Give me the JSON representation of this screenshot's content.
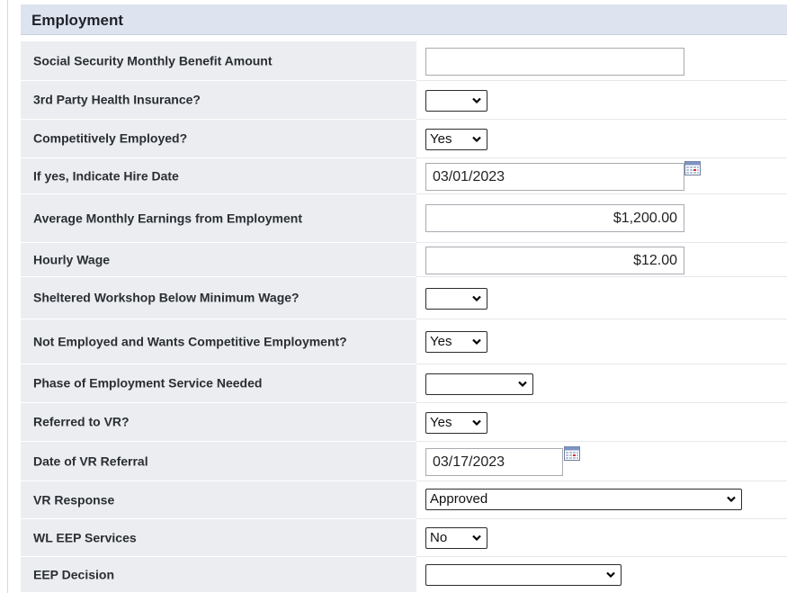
{
  "section": {
    "title": "Employment"
  },
  "fields": [
    {
      "label": "Social Security Monthly Benefit Amount",
      "type": "text",
      "value": ""
    },
    {
      "label": "3rd Party Health Insurance?",
      "type": "select",
      "value": ""
    },
    {
      "label": "Competitively Employed?",
      "type": "select",
      "value": "Yes"
    },
    {
      "label": "If yes, Indicate Hire Date",
      "type": "date",
      "value": "03/01/2023"
    },
    {
      "label": "Average Monthly Earnings from Employment",
      "type": "text",
      "value": "$1,200.00"
    },
    {
      "label": "Hourly Wage",
      "type": "text",
      "value": "$12.00"
    },
    {
      "label": "Sheltered Workshop Below Minimum Wage?",
      "type": "select",
      "value": ""
    },
    {
      "label": "Not Employed and Wants Competitive Employment?",
      "type": "select",
      "value": "Yes"
    },
    {
      "label": "Phase of Employment Service Needed",
      "type": "select",
      "value": ""
    },
    {
      "label": "Referred to VR?",
      "type": "select",
      "value": "Yes"
    },
    {
      "label": "Date of VR Referral",
      "type": "date",
      "value": "03/17/2023"
    },
    {
      "label": "VR Response",
      "type": "select",
      "value": "Approved"
    },
    {
      "label": "WL EEP Services",
      "type": "select",
      "value": "No"
    },
    {
      "label": "EEP Decision",
      "type": "select",
      "value": ""
    }
  ],
  "icons": {
    "calendar": "calendar-icon",
    "dropdown": "chevron-down-icon"
  },
  "colors": {
    "header_bg": "#dde3ef",
    "label_bg": "#ebedf0"
  }
}
